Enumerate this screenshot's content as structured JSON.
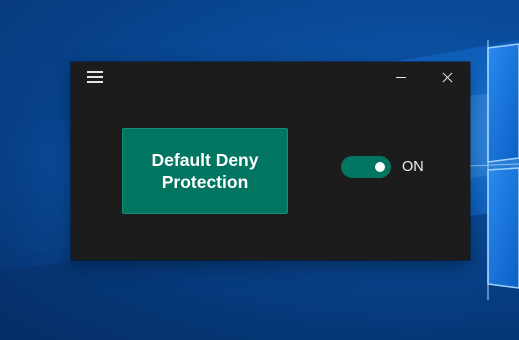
{
  "app": {
    "menu_icon": "hamburger-icon",
    "minimize_icon": "minimize-icon",
    "close_icon": "close-icon",
    "main_button_label": "Default Deny\nProtection",
    "toggle_state": "on",
    "toggle_label": "ON"
  },
  "colors": {
    "window_bg": "#1c1c1c",
    "accent": "#027561",
    "text": "#ffffff",
    "desktop_blue": "#0d5bb5"
  }
}
